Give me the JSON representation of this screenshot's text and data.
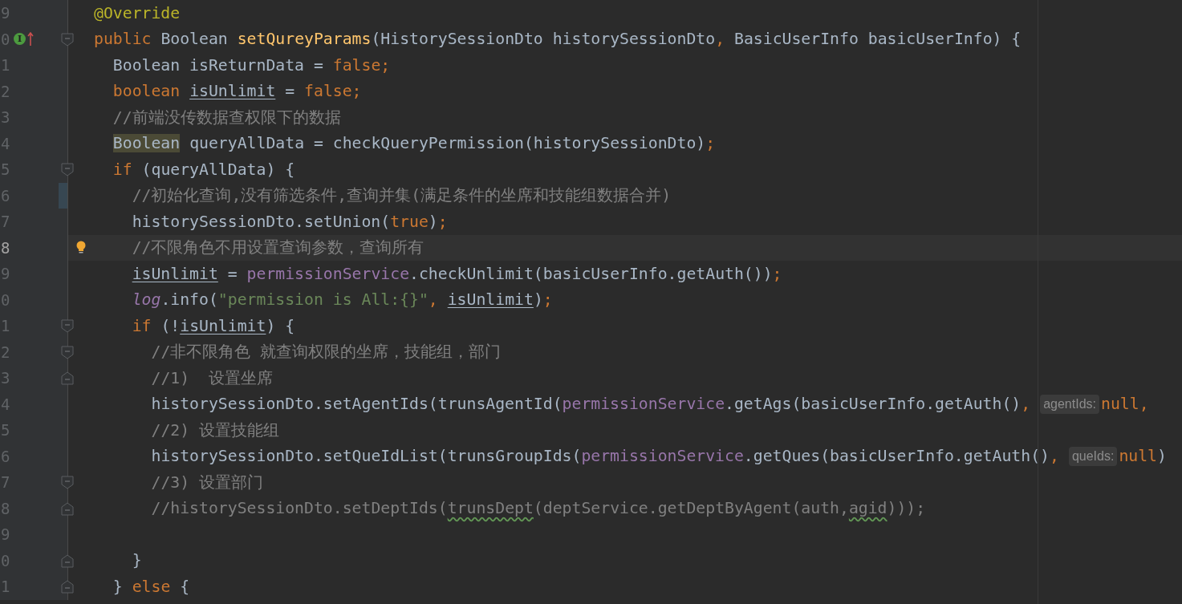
{
  "lines": [
    {
      "number": "9",
      "changed": false,
      "current": false,
      "fold_open": false,
      "fold_close": false,
      "tokens": [
        {
          "text": "@Override",
          "kind": "annotation"
        }
      ]
    },
    {
      "number": "0",
      "changed": false,
      "current": false,
      "fold_open": true,
      "fold_close": false,
      "gutter_icon": {
        "kind": "implements",
        "label": "I"
      },
      "tokens": [
        {
          "text": "public",
          "kind": "keyword"
        },
        {
          "text": " Boolean ",
          "kind": "plain"
        },
        {
          "text": "setQureyParams",
          "kind": "method"
        },
        {
          "text": "(HistorySessionDto historySessionDto",
          "kind": "plain"
        },
        {
          "text": ",",
          "kind": "keyword"
        },
        {
          "text": " BasicUserInfo basicUserInfo) {",
          "kind": "plain"
        }
      ]
    },
    {
      "number": "1",
      "changed": false,
      "current": false,
      "fold_open": false,
      "fold_close": false,
      "tokens": [
        {
          "text": "  Boolean isReturnData = ",
          "kind": "plain"
        },
        {
          "text": "false;",
          "kind": "keyword"
        }
      ]
    },
    {
      "number": "2",
      "changed": false,
      "current": false,
      "fold_open": false,
      "fold_close": false,
      "tokens": [
        {
          "text": "  boolean",
          "kind": "keyword"
        },
        {
          "text": " isUnlimit",
          "kind": "reassigned"
        },
        {
          "text": " = ",
          "kind": "plain"
        },
        {
          "text": "false;",
          "kind": "keyword"
        }
      ]
    },
    {
      "number": "3",
      "changed": false,
      "current": false,
      "fold_open": false,
      "fold_close": false,
      "tokens": [
        {
          "text": "  //前端没传数据查权限下的数据",
          "kind": "comment"
        }
      ]
    },
    {
      "number": "4",
      "changed": false,
      "current": false,
      "fold_open": false,
      "fold_close": false,
      "tokens": [
        {
          "text": "  Boolean",
          "kind": "highlight"
        },
        {
          "text": " queryAllData = checkQueryPermission(historySessionDto)",
          "kind": "plain"
        },
        {
          "text": ";",
          "kind": "keyword"
        }
      ]
    },
    {
      "number": "5",
      "changed": false,
      "current": false,
      "fold_open": true,
      "fold_close": false,
      "tokens": [
        {
          "text": "  if",
          "kind": "keyword"
        },
        {
          "text": " (queryAllData) {",
          "kind": "plain"
        }
      ]
    },
    {
      "number": "6",
      "changed": true,
      "current": false,
      "fold_open": false,
      "fold_close": false,
      "tokens": [
        {
          "text": "    //初始化查询,没有筛选条件,查询并集(满足条件的坐席和技能组数据合并)",
          "kind": "comment"
        }
      ]
    },
    {
      "number": "7",
      "changed": false,
      "current": false,
      "fold_open": false,
      "fold_close": false,
      "tokens": [
        {
          "text": "    historySessionDto.setUnion(",
          "kind": "plain"
        },
        {
          "text": "true",
          "kind": "keyword"
        },
        {
          "text": ")",
          "kind": "plain"
        },
        {
          "text": ";",
          "kind": "keyword"
        }
      ]
    },
    {
      "number": "8",
      "changed": false,
      "current": true,
      "fold_open": false,
      "fold_close": false,
      "gutter_icon": {
        "kind": "bulb"
      },
      "tokens": [
        {
          "text": "    //不限角色不用设置查询参数，查询所有",
          "kind": "comment"
        }
      ]
    },
    {
      "number": "9",
      "changed": false,
      "current": false,
      "fold_open": false,
      "fold_close": false,
      "tokens": [
        {
          "text": "    isUnlimit",
          "kind": "reassigned"
        },
        {
          "text": " = ",
          "kind": "plain"
        },
        {
          "text": "permissionService",
          "kind": "field"
        },
        {
          "text": ".checkUnlimit(basicUserInfo.getAuth())",
          "kind": "plain"
        },
        {
          "text": ";",
          "kind": "keyword"
        }
      ]
    },
    {
      "number": "0",
      "changed": false,
      "current": false,
      "fold_open": false,
      "fold_close": false,
      "tokens": [
        {
          "text": "    log",
          "kind": "static"
        },
        {
          "text": ".info(",
          "kind": "plain"
        },
        {
          "text": "\"permission is All:{}\"",
          "kind": "string"
        },
        {
          "text": ",",
          "kind": "keyword"
        },
        {
          "text": " isUnlimit",
          "kind": "reassigned"
        },
        {
          "text": ")",
          "kind": "plain"
        },
        {
          "text": ";",
          "kind": "keyword"
        }
      ]
    },
    {
      "number": "1",
      "changed": false,
      "current": false,
      "fold_open": true,
      "fold_close": false,
      "tokens": [
        {
          "text": "    if",
          "kind": "keyword"
        },
        {
          "text": " (!",
          "kind": "plain"
        },
        {
          "text": "isUnlimit",
          "kind": "reassigned"
        },
        {
          "text": ") {",
          "kind": "plain"
        }
      ]
    },
    {
      "number": "2",
      "changed": false,
      "current": false,
      "fold_open": true,
      "fold_close": false,
      "tokens": [
        {
          "text": "      //非不限角色 就查询权限的坐席，技能组，部门",
          "kind": "comment"
        }
      ]
    },
    {
      "number": "3",
      "changed": false,
      "current": false,
      "fold_open": false,
      "fold_close": true,
      "tokens": [
        {
          "text": "      //1)  设置坐席",
          "kind": "comment"
        }
      ]
    },
    {
      "number": "4",
      "changed": false,
      "current": false,
      "fold_open": false,
      "fold_close": false,
      "tokens": [
        {
          "text": "      historySessionDto.setAgentIds(trunsAgentId(",
          "kind": "plain"
        },
        {
          "text": "permissionService",
          "kind": "field"
        },
        {
          "text": ".getAgs(basicUserInfo.getAuth()",
          "kind": "plain"
        },
        {
          "text": ",",
          "kind": "keyword"
        },
        {
          "text": "agentIds:",
          "kind": "hint"
        },
        {
          "text": "null,",
          "kind": "keyword"
        }
      ]
    },
    {
      "number": "5",
      "changed": false,
      "current": false,
      "fold_open": false,
      "fold_close": false,
      "tokens": [
        {
          "text": "      //2) 设置技能组",
          "kind": "comment"
        }
      ]
    },
    {
      "number": "6",
      "changed": false,
      "current": false,
      "fold_open": false,
      "fold_close": false,
      "tokens": [
        {
          "text": "      historySessionDto.setQueIdList(trunsGroupIds(",
          "kind": "plain"
        },
        {
          "text": "permissionService",
          "kind": "field"
        },
        {
          "text": ".getQues(basicUserInfo.getAuth()",
          "kind": "plain"
        },
        {
          "text": ",",
          "kind": "keyword"
        },
        {
          "text": "queIds:",
          "kind": "hint"
        },
        {
          "text": "null",
          "kind": "keyword"
        },
        {
          "text": ")",
          "kind": "plain"
        }
      ]
    },
    {
      "number": "7",
      "changed": false,
      "current": false,
      "fold_open": true,
      "fold_close": false,
      "tokens": [
        {
          "text": "      //3) 设置部门",
          "kind": "comment"
        }
      ]
    },
    {
      "number": "8",
      "changed": false,
      "current": false,
      "fold_open": false,
      "fold_close": true,
      "tokens": [
        {
          "text": "      //historySessionDto.setDeptIds(",
          "kind": "comment"
        },
        {
          "text": "trunsDept",
          "kind": "typo"
        },
        {
          "text": "(deptService.getDeptByAgent(auth,",
          "kind": "comment"
        },
        {
          "text": "agid",
          "kind": "typo"
        },
        {
          "text": ")));",
          "kind": "comment"
        }
      ]
    },
    {
      "number": "9",
      "changed": false,
      "current": false,
      "fold_open": false,
      "fold_close": false
    },
    {
      "number": "0",
      "changed": false,
      "current": false,
      "fold_open": false,
      "fold_close": true,
      "tokens": [
        {
          "text": "    }",
          "kind": "plain"
        }
      ]
    },
    {
      "number": "1",
      "changed": false,
      "current": false,
      "fold_open": false,
      "fold_close": true,
      "tokens": [
        {
          "text": "  } ",
          "kind": "plain"
        },
        {
          "text": "else",
          "kind": "keyword"
        },
        {
          "text": " {",
          "kind": "plain"
        }
      ]
    }
  ]
}
